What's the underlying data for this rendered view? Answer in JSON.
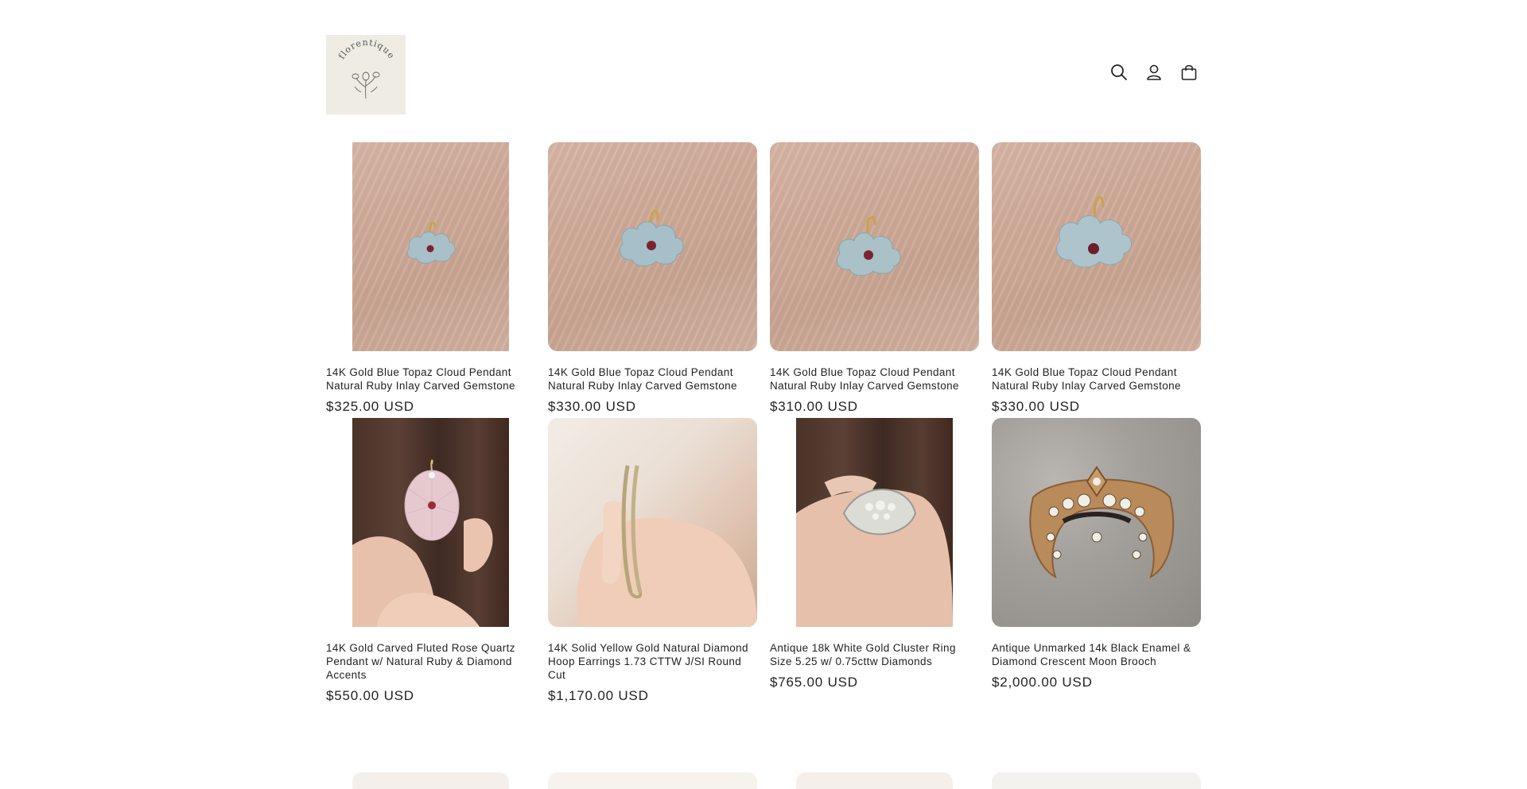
{
  "header": {
    "logo_text": "florentique",
    "icons": [
      "search-icon",
      "account-icon",
      "cart-icon"
    ]
  },
  "products": [
    {
      "title": "14K Gold Blue Topaz Cloud Pendant Natural Ruby Inlay Carved Gemstone",
      "price": "$325.00 USD",
      "image": "cloud-pendant-narrow"
    },
    {
      "title": "14K Gold Blue Topaz Cloud Pendant Natural Ruby Inlay Carved Gemstone",
      "price": "$330.00 USD",
      "image": "cloud-pendant"
    },
    {
      "title": "14K Gold Blue Topaz Cloud Pendant Natural Ruby Inlay Carved Gemstone",
      "price": "$310.00 USD",
      "image": "cloud-pendant"
    },
    {
      "title": "14K Gold Blue Topaz Cloud Pendant Natural Ruby Inlay Carved Gemstone",
      "price": "$330.00 USD",
      "image": "cloud-pendant"
    },
    {
      "title": "14K Gold Carved Fluted Rose Quartz Pendant w/ Natural Ruby & Diamond Accents",
      "price": "$550.00 USD",
      "image": "rose-quartz-pendant"
    },
    {
      "title": "14K Solid Yellow Gold Natural Diamond Hoop Earrings 1.73 CTTW J/SI Round Cut",
      "price": "$1,170.00 USD",
      "image": "hoop-earrings"
    },
    {
      "title": "Antique 18k White Gold Cluster Ring Size 5.25 w/ 0.75cttw Diamonds",
      "price": "$765.00 USD",
      "image": "cluster-ring"
    },
    {
      "title": "Antique Unmarked 14k Black Enamel & Diamond Crescent Moon Brooch",
      "price": "$2,000.00 USD",
      "image": "crescent-brooch"
    }
  ],
  "colors": {
    "logo_bg": "#eeece3",
    "text": "#222222",
    "background": "#ffffff"
  }
}
